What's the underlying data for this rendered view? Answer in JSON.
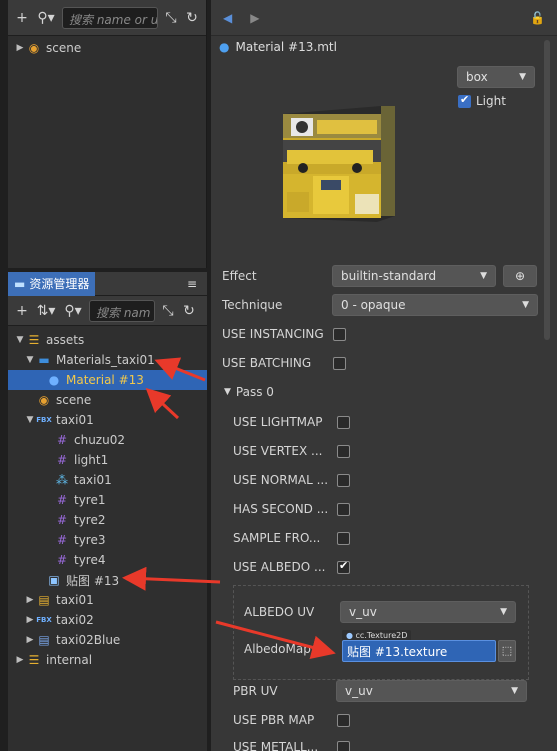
{
  "hierarchy": {
    "search_placeholder": "搜索 name or u",
    "items": [
      {
        "label": "scene"
      }
    ]
  },
  "assets": {
    "tab_label": "资源管理器",
    "search_placeholder": "搜索 nam",
    "tree": [
      {
        "label": "assets"
      },
      {
        "label": "Materials_taxi01"
      },
      {
        "label": "Material #13"
      },
      {
        "label": "scene"
      },
      {
        "label": "taxi01"
      },
      {
        "label": "chuzu02"
      },
      {
        "label": "light1"
      },
      {
        "label": "taxi01"
      },
      {
        "label": "tyre1"
      },
      {
        "label": "tyre2"
      },
      {
        "label": "tyre3"
      },
      {
        "label": "tyre4"
      },
      {
        "label": "贴图 #13"
      },
      {
        "label": "taxi01"
      },
      {
        "label": "taxi02"
      },
      {
        "label": "taxi02Blue"
      },
      {
        "label": "internal"
      }
    ]
  },
  "inspector": {
    "title": "Material #13.mtl",
    "preview_shape": "box",
    "light_label": "Light",
    "effect_label": "Effect",
    "effect_value": "builtin-standard",
    "technique_label": "Technique",
    "technique_value": "0 - opaque",
    "use_instancing": "USE INSTANCING",
    "use_batching": "USE BATCHING",
    "pass_label": "Pass 0",
    "pass_props": [
      "USE LIGHTMAP",
      "USE VERTEX ...",
      "USE NORMAL ...",
      "HAS SECOND ...",
      "SAMPLE FRO...",
      "USE ALBEDO ..."
    ],
    "albedo_uv_label": "ALBEDO UV",
    "albedo_uv_value": "v_uv",
    "albedo_map_label": "AlbedoMap",
    "texture_type": "cc.Texture2D",
    "albedo_map_value": "贴图 #13.texture",
    "pbr_uv_label": "PBR UV",
    "pbr_uv_value": "v_uv",
    "use_pbr_map": "USE PBR MAP",
    "use_metal": "USE METALL..."
  },
  "colors": {
    "selection": "#2f65b5",
    "arrow": "#e8392a",
    "folder": "#3d8ddc",
    "grid_icon": "#9a6adb"
  }
}
